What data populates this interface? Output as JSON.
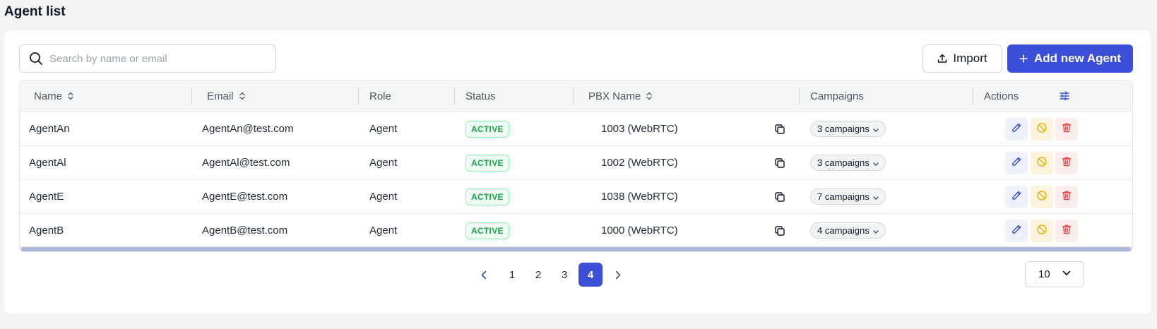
{
  "page": {
    "title": "Agent list"
  },
  "search": {
    "placeholder": "Search by name or email",
    "value": ""
  },
  "toolbar": {
    "import_label": "Import",
    "add_label": "Add new Agent"
  },
  "table": {
    "columns": [
      "Name",
      "Email",
      "Role",
      "Status",
      "PBX Name",
      "Campaigns",
      "Actions"
    ],
    "rows": [
      {
        "name": "AgentAn",
        "email": "AgentAn@test.com",
        "role": "Agent",
        "status": "ACTIVE",
        "pbx": "1003 (WebRTC)",
        "campaigns": "3 campaigns"
      },
      {
        "name": "AgentAl",
        "email": "AgentAl@test.com",
        "role": "Agent",
        "status": "ACTIVE",
        "pbx": "1002 (WebRTC)",
        "campaigns": "3 campaigns"
      },
      {
        "name": "AgentE",
        "email": "AgentE@test.com",
        "role": "Agent",
        "status": "ACTIVE",
        "pbx": "1038 (WebRTC)",
        "campaigns": "7 campaigns"
      },
      {
        "name": "AgentB",
        "email": "AgentB@test.com",
        "role": "Agent",
        "status": "ACTIVE",
        "pbx": "1000 (WebRTC)",
        "campaigns": "4 campaigns"
      }
    ]
  },
  "pagination": {
    "pages": [
      "1",
      "2",
      "3",
      "4"
    ],
    "current": "4",
    "page_size": "10"
  },
  "colors": {
    "accent": "#3b4fd8",
    "active_badge": "#16a34a",
    "block_icon": "#eab308",
    "delete_icon": "#ef4444"
  },
  "icons": [
    "search-icon",
    "upload-icon",
    "plus-icon",
    "sort-icon",
    "column-settings-icon",
    "copy-icon",
    "chevron-down-icon",
    "edit-icon",
    "block-icon",
    "trash-icon",
    "chevron-left-icon",
    "chevron-right-icon"
  ]
}
